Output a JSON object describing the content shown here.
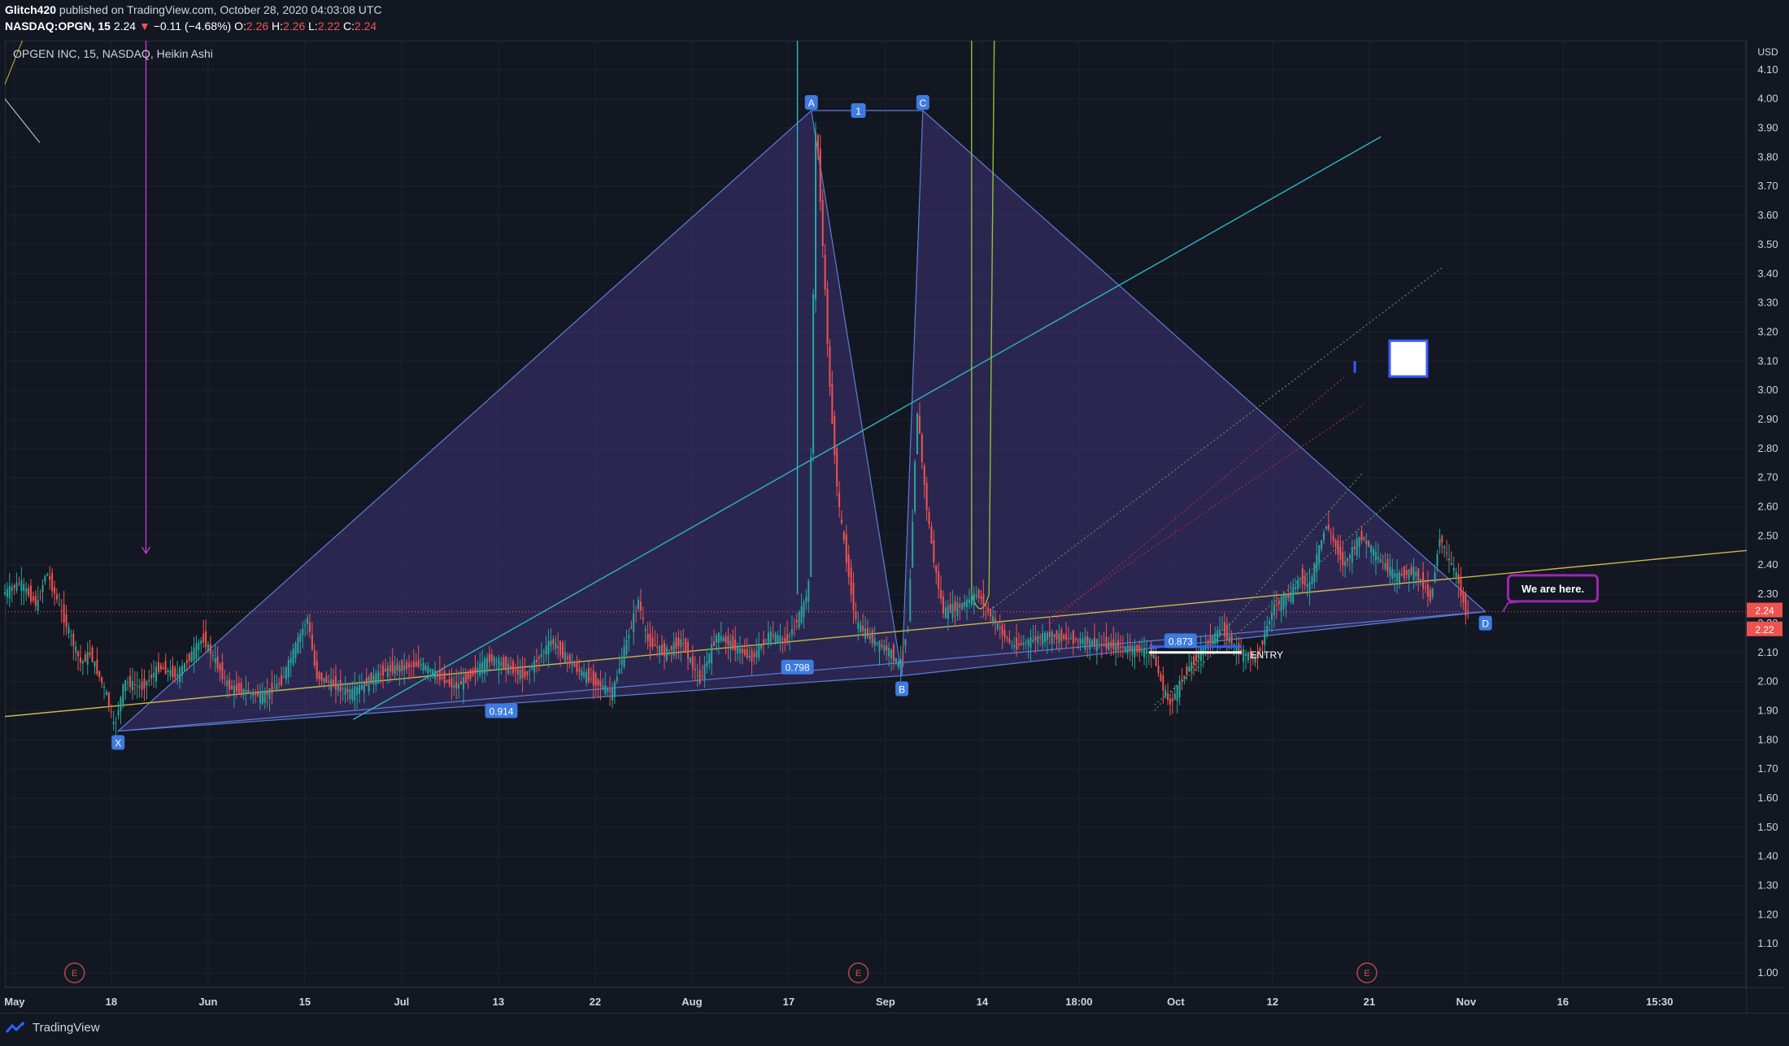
{
  "header": {
    "author": "Glitch420",
    "published_text": "published on TradingView.com, October 28, 2020 04:03:08 UTC",
    "symbol": "NASDAQ:OPGN, 15",
    "last": "2.24",
    "change": "−0.11 (−4.68%)",
    "o_label": "O:",
    "o_value": "2.26",
    "h_label": "H:",
    "h_value": "2.26",
    "l_label": "L:",
    "l_value": "2.22",
    "c_label": "C:",
    "c_value": "2.24"
  },
  "chart_title": "OPGEN INC, 15, NASDAQ, Heikin Ashi",
  "currency": "USD",
  "footer_brand": "TradingView",
  "colors": {
    "background": "#131722",
    "up": "#26a69a",
    "down": "#ef5350",
    "pattern_fill": "#4a3a8a",
    "pattern_line": "#5b7fd6",
    "trend_yellow": "#c8b84a",
    "trend_cyan": "#2ab7c4",
    "magenta": "#d63bd6",
    "badge": "#3d7be0",
    "callout": "#9c27b0"
  },
  "chart_data": {
    "type": "candlestick",
    "chart_style": "Heikin Ashi",
    "x_tick_labels": [
      "May",
      "18",
      "Jun",
      "15",
      "Jul",
      "13",
      "22",
      "Aug",
      "17",
      "Sep",
      "14",
      "18:00",
      "Oct",
      "12",
      "21",
      "Nov",
      "16",
      "15:30"
    ],
    "y_tick_labels": [
      "1.00",
      "1.10",
      "1.20",
      "1.30",
      "1.40",
      "1.50",
      "1.60",
      "1.70",
      "1.80",
      "1.90",
      "2.00",
      "2.10",
      "2.20",
      "2.30",
      "2.40",
      "2.50",
      "2.60",
      "2.70",
      "2.80",
      "2.90",
      "3.00",
      "3.10",
      "3.20",
      "3.30",
      "3.40",
      "3.50",
      "3.60",
      "3.70",
      "3.80",
      "3.90",
      "4.00",
      "4.10"
    ],
    "ylim": [
      0.95,
      4.2
    ],
    "price_labels": [
      {
        "text": "2.24",
        "value": 2.24
      },
      {
        "text": "2.22",
        "value": 2.22
      }
    ],
    "price_path": [
      [
        0,
        2.3
      ],
      [
        0.01,
        2.34
      ],
      [
        0.02,
        2.26
      ],
      [
        0.025,
        2.38
      ],
      [
        0.035,
        2.22
      ],
      [
        0.045,
        2.06
      ],
      [
        0.05,
        2.1
      ],
      [
        0.06,
        1.95
      ],
      [
        0.064,
        1.84
      ],
      [
        0.07,
        2.0
      ],
      [
        0.08,
        1.98
      ],
      [
        0.09,
        2.05
      ],
      [
        0.1,
        2.02
      ],
      [
        0.115,
        2.15
      ],
      [
        0.13,
        1.98
      ],
      [
        0.15,
        1.95
      ],
      [
        0.16,
        2.0
      ],
      [
        0.175,
        2.22
      ],
      [
        0.18,
        2.02
      ],
      [
        0.2,
        1.96
      ],
      [
        0.22,
        2.04
      ],
      [
        0.24,
        2.06
      ],
      [
        0.26,
        1.98
      ],
      [
        0.28,
        2.08
      ],
      [
        0.3,
        2.02
      ],
      [
        0.315,
        2.14
      ],
      [
        0.33,
        2.04
      ],
      [
        0.35,
        1.96
      ],
      [
        0.365,
        2.28
      ],
      [
        0.37,
        2.14
      ],
      [
        0.38,
        2.1
      ],
      [
        0.39,
        2.14
      ],
      [
        0.4,
        2.0
      ],
      [
        0.41,
        2.16
      ],
      [
        0.43,
        2.08
      ],
      [
        0.44,
        2.16
      ],
      [
        0.45,
        2.14
      ],
      [
        0.46,
        2.26
      ],
      [
        0.463,
        2.34
      ],
      [
        0.467,
        3.95
      ],
      [
        0.47,
        3.6
      ],
      [
        0.475,
        3.0
      ],
      [
        0.48,
        2.6
      ],
      [
        0.49,
        2.2
      ],
      [
        0.5,
        2.14
      ],
      [
        0.51,
        2.1
      ],
      [
        0.515,
        2.05
      ],
      [
        0.52,
        2.2
      ],
      [
        0.525,
        2.94
      ],
      [
        0.53,
        2.62
      ],
      [
        0.535,
        2.4
      ],
      [
        0.54,
        2.24
      ],
      [
        0.55,
        2.26
      ],
      [
        0.56,
        2.3
      ],
      [
        0.57,
        2.2
      ],
      [
        0.58,
        2.12
      ],
      [
        0.6,
        2.16
      ],
      [
        0.62,
        2.14
      ],
      [
        0.64,
        2.12
      ],
      [
        0.66,
        2.1
      ],
      [
        0.665,
        2.0
      ],
      [
        0.67,
        1.92
      ],
      [
        0.68,
        2.04
      ],
      [
        0.69,
        2.12
      ],
      [
        0.7,
        2.18
      ],
      [
        0.71,
        2.1
      ],
      [
        0.72,
        2.08
      ],
      [
        0.73,
        2.26
      ],
      [
        0.74,
        2.3
      ],
      [
        0.745,
        2.36
      ],
      [
        0.75,
        2.32
      ],
      [
        0.755,
        2.44
      ],
      [
        0.76,
        2.54
      ],
      [
        0.77,
        2.4
      ],
      [
        0.78,
        2.5
      ],
      [
        0.79,
        2.42
      ],
      [
        0.8,
        2.36
      ],
      [
        0.81,
        2.38
      ],
      [
        0.815,
        2.34
      ],
      [
        0.82,
        2.28
      ],
      [
        0.825,
        2.5
      ],
      [
        0.83,
        2.42
      ],
      [
        0.835,
        2.36
      ],
      [
        0.84,
        2.24
      ]
    ],
    "harmonic_pattern": {
      "points": [
        {
          "label": "X",
          "value": 1.83
        },
        {
          "label": "A",
          "value": 3.96
        },
        {
          "label": "B",
          "value": 2.02
        },
        {
          "label": "C",
          "value": 3.96
        },
        {
          "label": "D",
          "value": 2.24
        }
      ],
      "ratios": [
        "1",
        "0.914",
        "0.798",
        "0.873"
      ]
    },
    "annotations": [
      "ENTRY",
      "We are here."
    ],
    "earnings_markers": [
      "E",
      "E",
      "E"
    ]
  }
}
